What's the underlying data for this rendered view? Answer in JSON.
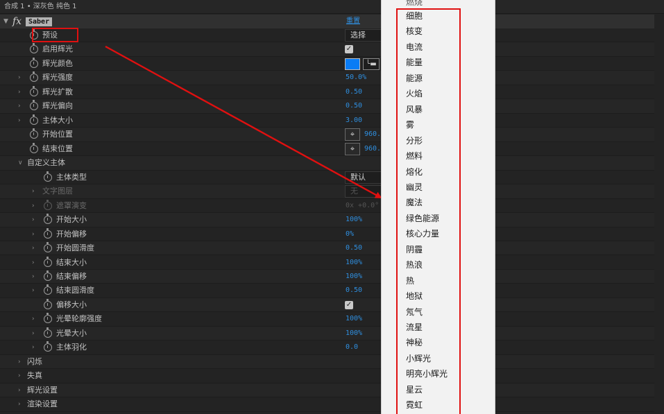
{
  "header": {
    "breadcrumb": "合成 1 • 深灰色 纯色 1"
  },
  "effect": {
    "fx_symbol": "fx",
    "name": "Saber",
    "reset_label": "重置"
  },
  "properties": [
    {
      "label": "预设",
      "control": "dropdown",
      "value": "选择"
    },
    {
      "label": "启用辉光",
      "control": "checkbox",
      "value": "✓"
    },
    {
      "label": "辉光颜色",
      "control": "color",
      "color": "#0a7cf5",
      "icon": "eyedropper-icon"
    },
    {
      "label": "辉光强度",
      "control": "number",
      "value": "50.0%"
    },
    {
      "label": "辉光扩散",
      "control": "number",
      "value": "0.50"
    },
    {
      "label": "辉光偏向",
      "control": "number",
      "value": "0.50"
    },
    {
      "label": "主体大小",
      "control": "number",
      "value": "3.00"
    },
    {
      "label": "开始位置",
      "control": "point",
      "value": "960."
    },
    {
      "label": "结束位置",
      "control": "point",
      "value": "960."
    },
    {
      "label": "自定义主体",
      "control": "group"
    },
    {
      "label": "主体类型",
      "control": "dropdown",
      "value": "默认"
    },
    {
      "label": "文字图层",
      "control": "dropdown",
      "value": "无",
      "disabled": true
    },
    {
      "label": "遮罩演变",
      "control": "number",
      "value": "0x +0.0°",
      "disabled": true
    },
    {
      "label": "开始大小",
      "control": "number",
      "value": "100%"
    },
    {
      "label": "开始偏移",
      "control": "number",
      "value": "0%"
    },
    {
      "label": "开始圆滑度",
      "control": "number",
      "value": "0.50"
    },
    {
      "label": "结束大小",
      "control": "number",
      "value": "100%"
    },
    {
      "label": "结束偏移",
      "control": "number",
      "value": "100%"
    },
    {
      "label": "结束圆滑度",
      "control": "number",
      "value": "0.50"
    },
    {
      "label": "偏移大小",
      "control": "checkbox",
      "value": "✓"
    },
    {
      "label": "光晕轮廓强度",
      "control": "number",
      "value": "100%"
    },
    {
      "label": "光晕大小",
      "control": "number",
      "value": "100%"
    },
    {
      "label": "主体羽化",
      "control": "number",
      "value": "0.0"
    },
    {
      "label": "闪烁",
      "control": "group"
    },
    {
      "label": "失真",
      "control": "group"
    },
    {
      "label": "辉光设置",
      "control": "group"
    },
    {
      "label": "渲染设置",
      "control": "group"
    }
  ],
  "preset_menu": {
    "partial_item": "燃烧",
    "items": [
      "细胞",
      "核变",
      "电流",
      "能量",
      "能源",
      "火焰",
      "风暴",
      "雾",
      "分形",
      "燃料",
      "熔化",
      "幽灵",
      "魔法",
      "绿色能源",
      "核心力量",
      "阴霾",
      "热浪",
      "热",
      "地狱",
      "氖气",
      "流星",
      "神秘",
      "小辉光",
      "明亮小辉光",
      "星云",
      "霓虹"
    ]
  },
  "colors": {
    "panel_bg": "#232323",
    "value_blue": "#2f8fe0",
    "annotation_red": "#e01010",
    "menu_bg": "#f2f2f2"
  }
}
